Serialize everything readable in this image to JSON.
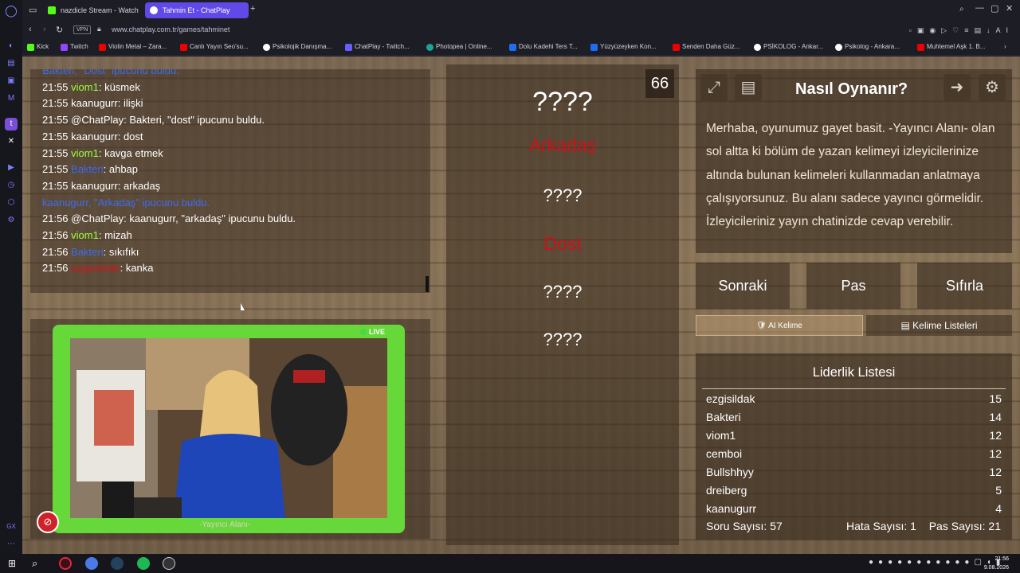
{
  "browser": {
    "tabs": [
      {
        "label": "nazdicle Stream - Watch Li",
        "color": "#53fc18"
      },
      {
        "label": "Tahmin Et - ChatPlay",
        "color": "#ffffff"
      }
    ],
    "vpn": "VPN",
    "url": "www.chatplay.com.tr/games/tahminet",
    "bookmarks": [
      "Kick",
      "Twitch",
      "Violin Metal – Zara...",
      "Canlı Yayın Seo'su...",
      "Psikolojik Danışma...",
      "ChatPlay - Twitch...",
      "Photopea | Online...",
      "Dolu Kadehi Ters T...",
      "Yüzyüzeyken Kon...",
      "Senden Daha Güz...",
      "PSİKOLOG - Ankar...",
      "Psikolog - Ankara...",
      "Muhtemel Aşk 1. B..."
    ],
    "toolbar_ai": "AI"
  },
  "chat": {
    "lines": [
      {
        "time": "",
        "user": "Bakteri,",
        "user_color": "blue",
        "sep": " ",
        "msg": "\"Dost\" ipucunu buldu.",
        "msg_color": "blue"
      },
      {
        "time": "21:55 ",
        "user": "viom1",
        "user_color": "green",
        "sep": ": ",
        "msg": "küsmek",
        "msg_color": ""
      },
      {
        "time": "21:55 ",
        "user": "kaanugurr",
        "user_color": "",
        "sep": ": ",
        "msg": "ilişki",
        "msg_color": ""
      },
      {
        "time": "21:55 ",
        "user": "@ChatPlay",
        "user_color": "",
        "sep": ": ",
        "msg": "Bakteri, \"dost\" ipucunu buldu.",
        "msg_color": ""
      },
      {
        "time": "21:55 ",
        "user": "kaanugurr",
        "user_color": "",
        "sep": ": ",
        "msg": "dost",
        "msg_color": ""
      },
      {
        "time": "21:55 ",
        "user": "viom1",
        "user_color": "green",
        "sep": ": ",
        "msg": "kavga etmek",
        "msg_color": ""
      },
      {
        "time": "21:55 ",
        "user": "Bakteri",
        "user_color": "blue",
        "sep": ": ",
        "msg": "ahbap",
        "msg_color": ""
      },
      {
        "time": "21:55 ",
        "user": "kaanugurr",
        "user_color": "",
        "sep": ": ",
        "msg": "arkadaş",
        "msg_color": ""
      },
      {
        "time": "",
        "user": "kaanugurr,",
        "user_color": "blue",
        "sep": " ",
        "msg": "\"Arkadaş\" ipucunu buldu.",
        "msg_color": "blue"
      },
      {
        "time": "21:56 ",
        "user": "@ChatPlay",
        "user_color": "",
        "sep": ": ",
        "msg": "kaanugurr, \"arkadaş\" ipucunu buldu.",
        "msg_color": ""
      },
      {
        "time": "21:56 ",
        "user": "viom1",
        "user_color": "green",
        "sep": ": ",
        "msg": "mizah",
        "msg_color": ""
      },
      {
        "time": "21:56 ",
        "user": "Bakteri",
        "user_color": "blue",
        "sep": ": ",
        "msg": "sıkıfıkı",
        "msg_color": ""
      },
      {
        "time": "21:56 ",
        "user": "ezgiseldak",
        "user_color": "red",
        "sep": ": ",
        "msg": "kanka",
        "msg_color": ""
      }
    ]
  },
  "camera": {
    "live_label": "LIVE",
    "caption": "-Yayıncı Alanı-"
  },
  "game": {
    "counter": "66",
    "words": [
      {
        "text": "????",
        "revealed": false
      },
      {
        "text": "Arkadaş",
        "revealed": true
      },
      {
        "text": "????",
        "revealed": false
      },
      {
        "text": "Dost",
        "revealed": true
      },
      {
        "text": "????",
        "revealed": false
      },
      {
        "text": "????",
        "revealed": false
      }
    ]
  },
  "howto": {
    "title": "Nasıl Oynanır?",
    "text": "Merhaba, oyunumuz gayet basit. -Yayıncı Alanı- olan sol altta ki bölüm de yazan kelimeyi izleyicilerinize altında bulunan kelimeleri kullanmadan anlatmaya çalışıyorsunuz. Bu alanı sadece yayıncı görmelidir. İzleyicileriniz yayın chatinizde cevap verebilir."
  },
  "controls": {
    "next": "Sonraki",
    "pass": "Pas",
    "reset": "Sıfırla",
    "ai_tab": "AI Kelime",
    "list_tab": "Kelime Listeleri"
  },
  "leaderboard": {
    "title": "Liderlik Listesi",
    "rows": [
      {
        "name": "ezgisildak",
        "score": "15"
      },
      {
        "name": "Bakteri",
        "score": "14"
      },
      {
        "name": "viom1",
        "score": "12"
      },
      {
        "name": "cemboi",
        "score": "12"
      },
      {
        "name": "Bullshhyy",
        "score": "12"
      },
      {
        "name": "dreiberg",
        "score": "5"
      },
      {
        "name": "kaanugurr",
        "score": "4"
      }
    ],
    "stats": {
      "questions_label": "Soru Sayısı:",
      "questions": "57",
      "errors_label": "Hata Sayısı:",
      "errors": "1",
      "passes_label": "Pas Sayısı:",
      "passes": "21"
    }
  },
  "taskbar": {
    "time": "21:56",
    "date": "9.08.2026"
  },
  "colors": {
    "accent": "#6148e8",
    "green_user": "#9cff3c",
    "blue_user": "#3b6cf0",
    "red_user": "#d0141c",
    "live_frame": "#66d83a"
  }
}
